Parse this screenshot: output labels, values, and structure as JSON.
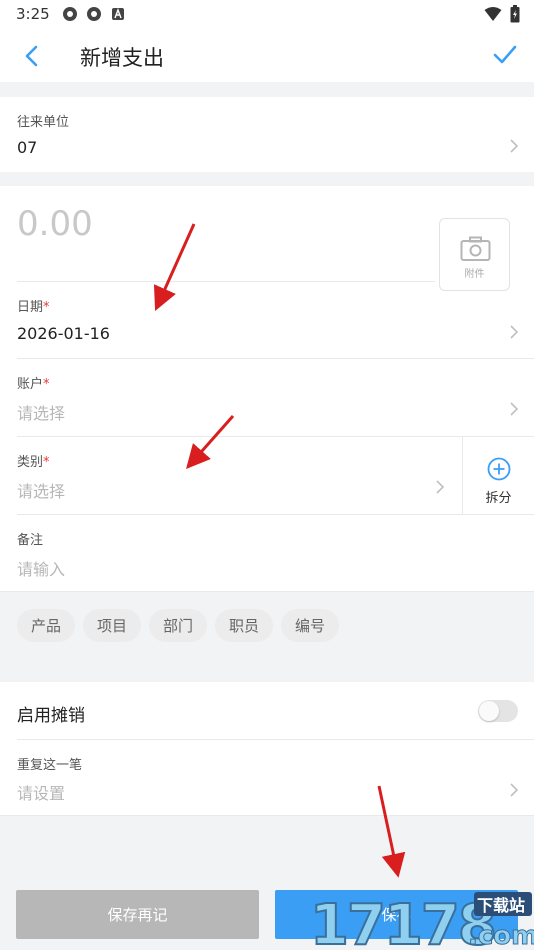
{
  "status_bar": {
    "time": "3:25"
  },
  "nav": {
    "title": "新增支出"
  },
  "partner": {
    "label": "往来单位",
    "value": "07"
  },
  "amount": {
    "value": "0.00",
    "attachment_label": "附件"
  },
  "date": {
    "label": "日期",
    "required_mark": "*",
    "value": "2026-01-16"
  },
  "account": {
    "label": "账户",
    "required_mark": "*",
    "placeholder": "请选择"
  },
  "category": {
    "label": "类别",
    "required_mark": "*",
    "placeholder": "请选择",
    "split_label": "拆分"
  },
  "remark": {
    "label": "备注",
    "placeholder": "请输入"
  },
  "tags": [
    "产品",
    "项目",
    "部门",
    "职员",
    "编号"
  ],
  "amortize": {
    "label": "启用摊销",
    "enabled": false
  },
  "repeat": {
    "label": "重复这一笔",
    "placeholder": "请设置"
  },
  "buttons": {
    "save_and_new": "保存再记",
    "save": "保存"
  },
  "watermark": {
    "number": "17178",
    "site_text": "下载站",
    "domain_text": ".com"
  },
  "colors": {
    "accent": "#3a9ef5",
    "required": "#e53935",
    "annotation_arrow": "#d81e1e"
  }
}
